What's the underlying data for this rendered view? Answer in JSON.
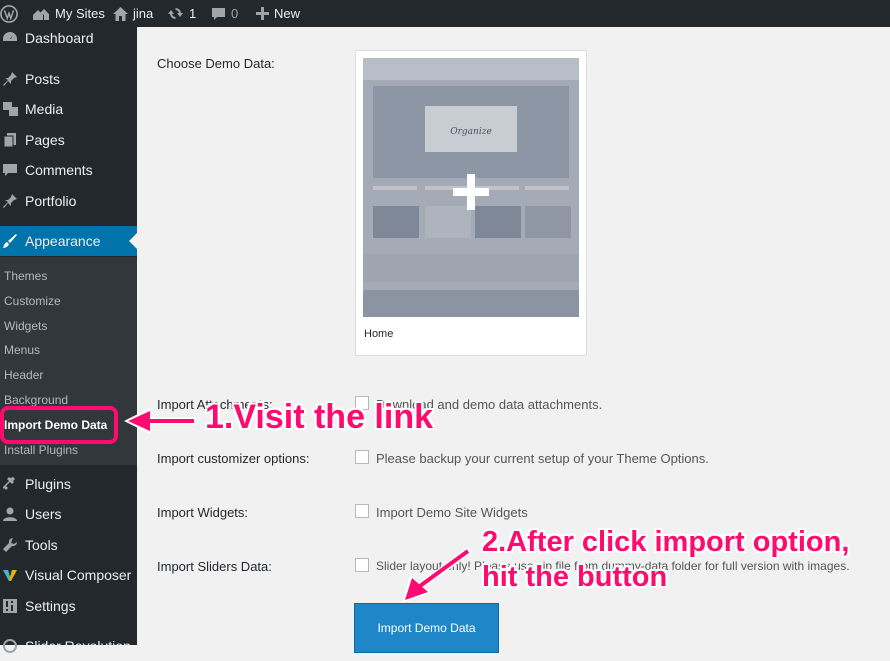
{
  "adminbar": {
    "my_sites": "My Sites",
    "site_name": "jina",
    "updates_count": "1",
    "comments_count": "0",
    "new_label": "New"
  },
  "sidebar": {
    "items": [
      {
        "label": "Dashboard",
        "icon": "dashboard-icon"
      },
      {
        "label": "Posts",
        "icon": "pin-icon"
      },
      {
        "label": "Media",
        "icon": "media-icon"
      },
      {
        "label": "Pages",
        "icon": "pages-icon"
      },
      {
        "label": "Comments",
        "icon": "comment-icon"
      },
      {
        "label": "Portfolio",
        "icon": "pin-icon"
      },
      {
        "label": "Appearance",
        "icon": "brush-icon"
      },
      {
        "label": "Plugins",
        "icon": "plug-icon"
      },
      {
        "label": "Users",
        "icon": "users-icon"
      },
      {
        "label": "Tools",
        "icon": "wrench-icon"
      },
      {
        "label": "Visual Composer",
        "icon": "vc-icon"
      },
      {
        "label": "Settings",
        "icon": "settings-icon"
      },
      {
        "label": "Slider Revolution",
        "icon": "refresh-icon"
      }
    ],
    "submenu": [
      "Themes",
      "Customize",
      "Widgets",
      "Menus",
      "Header",
      "Background",
      "Import Demo Data",
      "Install Plugins"
    ]
  },
  "main": {
    "choose_demo_label": "Choose Demo Data:",
    "demo_name": "Home",
    "thumb_title": "Organize",
    "rows": [
      {
        "label": "Import Attachments:",
        "text": "Download and demo data attachments."
      },
      {
        "label": "Import customizer options:",
        "text": "Please backup your current setup of your Theme Options."
      },
      {
        "label": "Import Widgets:",
        "text": "Import Demo Site Widgets"
      },
      {
        "label": "Import Sliders Data:",
        "text": "Slider layout only! Please use zip file from dummy-data folder for full version with images."
      }
    ],
    "button_label": "Import Demo Data"
  },
  "annotations": {
    "step1": "1.Visit the link",
    "step2_line1": "2.After click import option,",
    "step2_line2": "hit the button",
    "color": "#ff0b70"
  },
  "colors": {
    "adminbar_bg": "#23282d",
    "active_menu": "#0073aa",
    "button": "#1f87c7"
  }
}
